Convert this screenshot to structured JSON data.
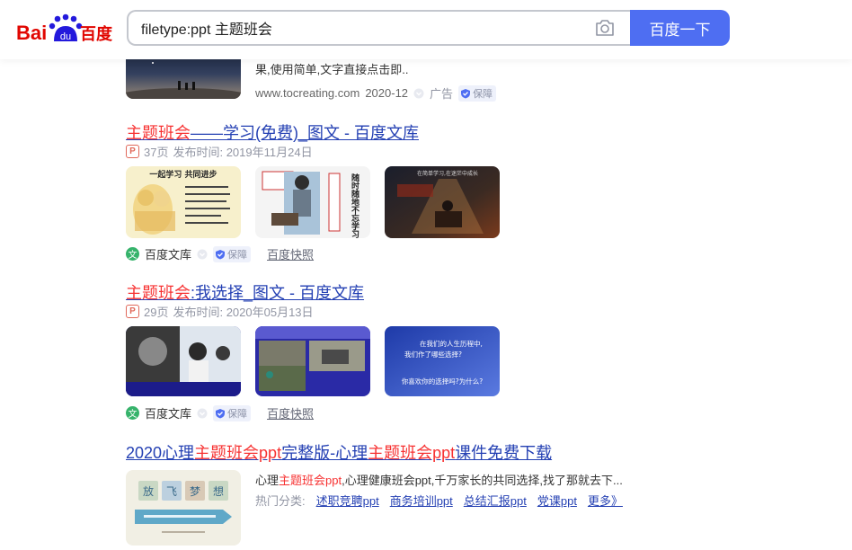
{
  "header": {
    "logo_text_left": "Bai",
    "logo_text_paw": "du",
    "logo_text_right": "百度",
    "search_value": "filetype:ppt 主题班会",
    "search_button": "百度一下",
    "icons": {
      "camera": "camera-icon"
    },
    "colors": {
      "accent": "#4e6ef2",
      "logo_red": "#e10601",
      "logo_blue": "#2319dc"
    }
  },
  "ad": {
    "snippet": "果,使用简单,文字直接点击即..",
    "url": "www.tocreating.com",
    "date": "2020-12",
    "tag": "广告",
    "badge": "保障"
  },
  "results": [
    {
      "title_em": "主题班会",
      "title_rest": "——学习(免费)_图文 - 百度文库",
      "pages": "37页",
      "date": "发布时间: 2019年11月24日",
      "source": "百度文库",
      "badge": "保障",
      "snapshot": "百度快照"
    },
    {
      "title_em": "主题班会",
      "title_rest": ":我选择_图文 - 百度文库",
      "pages": "29页",
      "date": "发布时间: 2020年05月13日",
      "source": "百度文库",
      "badge": "保障",
      "snapshot": "百度快照"
    },
    {
      "title_p1": "2020心理",
      "title_em1": "主题班会ppt",
      "title_p2": "完整版-心理",
      "title_em2": "主题班会ppt",
      "title_p3": "课件免费下载",
      "snippet_p1": "心理",
      "snippet_em": "主题班会ppt",
      "snippet_p2": ",心理健康班会ppt,千万家长的共同选择,找了那就去下...",
      "cats_label": "热门分类:",
      "cats": [
        "述职竞聘ppt",
        "商务培训ppt",
        "总结汇报ppt",
        "党课ppt",
        "更多》"
      ]
    }
  ],
  "thumb_text": {
    "r1a_title": "一起学习  共同进步",
    "r1b_side": "随时随地不忘学习",
    "r1c_caption": "在简单学习,在迷茫中成长",
    "r2c_line1": "在我们的人生历程中,",
    "r2c_line2": "我们作了哪些选择?",
    "r2c_line3": "你喜欢你的选择吗?为什么?",
    "r3_chars": [
      "放",
      "飞",
      "梦",
      "想"
    ],
    "ppt_icon": "P",
    "wen_icon": "文"
  }
}
